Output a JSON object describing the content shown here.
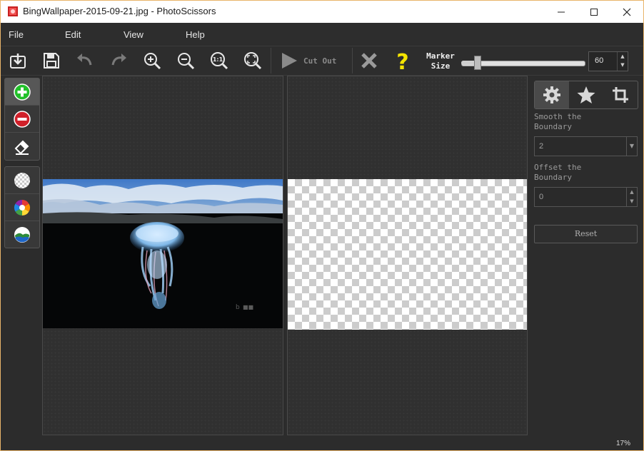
{
  "window": {
    "title": "BingWallpaper-2015-09-21.jpg - PhotoScissors"
  },
  "menu": {
    "items": [
      "File",
      "Edit",
      "View",
      "Help"
    ]
  },
  "toolbar": {
    "cut_out_label": "Cut Out",
    "marker_label_line1": "Marker",
    "marker_label_line2": "Size",
    "marker_size": "60",
    "marker_slider_fraction": 0.12,
    "icons": [
      "open-icon",
      "save-icon",
      "undo-icon",
      "redo-icon",
      "zoom-in-icon",
      "zoom-out-icon",
      "zoom-actual-icon",
      "zoom-fit-icon",
      "play-icon",
      "close-x-icon",
      "help-icon"
    ]
  },
  "left_tools": {
    "icons": [
      "add-marker-icon",
      "remove-marker-icon",
      "eraser-icon",
      "transparent-bg-icon",
      "color-bg-icon",
      "image-bg-icon"
    ]
  },
  "right_panel": {
    "tabs": [
      "settings-tab",
      "effects-tab",
      "crop-tab"
    ],
    "smooth_label_line1": "Smooth the",
    "smooth_label_line2": "Boundary",
    "smooth_value": "2",
    "offset_label_line1": "Offset the",
    "offset_label_line2": "Boundary",
    "offset_value": "0",
    "reset_label": "Reset"
  },
  "status": {
    "zoom": "17%"
  },
  "colors": {
    "accent_green": "#22c02a",
    "accent_red": "#d0202a",
    "help_yellow": "#f5e400",
    "border_accent": "#e8b46a"
  }
}
